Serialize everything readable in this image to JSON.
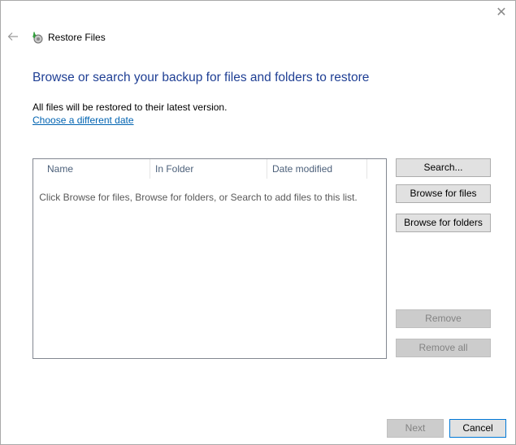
{
  "window": {
    "title": "Restore Files",
    "close_glyph": "✕",
    "back_glyph": "←"
  },
  "main": {
    "heading": "Browse or search your backup for files and folders to restore",
    "info": "All files will be restored to their latest version.",
    "change_date_link": "Choose a different date"
  },
  "list": {
    "columns": [
      "Name",
      "In Folder",
      "Date modified"
    ],
    "empty_message": "Click Browse for files, Browse for folders, or Search to add files to this list."
  },
  "side_buttons": {
    "search": "Search...",
    "browse_files": "Browse for files",
    "browse_folders": "Browse for folders",
    "remove": "Remove",
    "remove_all": "Remove all"
  },
  "footer": {
    "next": "Next",
    "cancel": "Cancel"
  },
  "colors": {
    "heading": "#1f3f94",
    "link": "#0063b1",
    "primary_border": "#0078d7"
  }
}
